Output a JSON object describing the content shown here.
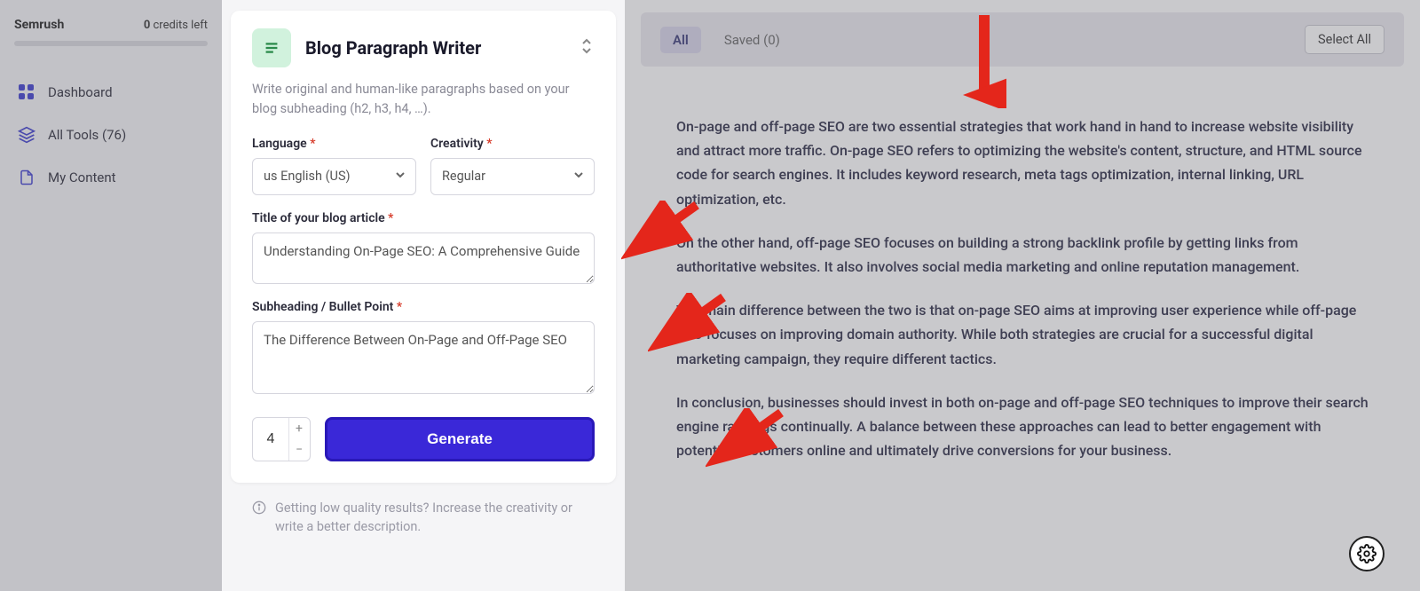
{
  "sidebar": {
    "brand": "Semrush",
    "credits_num": "0",
    "credits_text": " credits left",
    "nav": [
      {
        "label": "Dashboard"
      },
      {
        "label": "All Tools (76)"
      },
      {
        "label": "My Content"
      }
    ]
  },
  "tool": {
    "title": "Blog Paragraph Writer",
    "description": "Write original and human-like paragraphs based on your blog subheading (h2, h3, h4, …).",
    "fields": {
      "language_label": "Language",
      "language_value": "us English (US)",
      "creativity_label": "Creativity",
      "creativity_value": "Regular",
      "title_label": "Title of your blog article",
      "title_value": "Understanding On-Page SEO: A Comprehensive Guide",
      "subheading_label": "Subheading / Bullet Point",
      "subheading_value": "The Difference Between On-Page and Off-Page SEO"
    },
    "count": "4",
    "generate": "Generate",
    "hint": "Getting low quality results? Increase the creativity or write a better description."
  },
  "toolbar": {
    "all": "All",
    "saved": "Saved (0)",
    "select_all": "Select All"
  },
  "result": {
    "p1": "On-page and off-page SEO are two essential strategies that work hand in hand to increase website visibility and attract more traffic. On-page SEO refers to optimizing the website's content, structure, and HTML source code for search engines. It includes keyword research, meta tags optimization, internal linking, URL optimization, etc.",
    "p2": "On the other hand, off-page SEO focuses on building a strong backlink profile by getting links from authoritative websites. It also involves social media marketing and online reputation management.",
    "p3": "The main difference between the two is that on-page SEO aims at improving user experience while off-page SEO focuses on improving domain authority. While both strategies are crucial for a successful digital marketing campaign, they require different tactics.",
    "p4": "In conclusion, businesses should invest in both on-page and off-page SEO techniques to improve their search engine rankings continually. A balance between these approaches can lead to better engagement with potential customers online and ultimately drive conversions for your business."
  }
}
